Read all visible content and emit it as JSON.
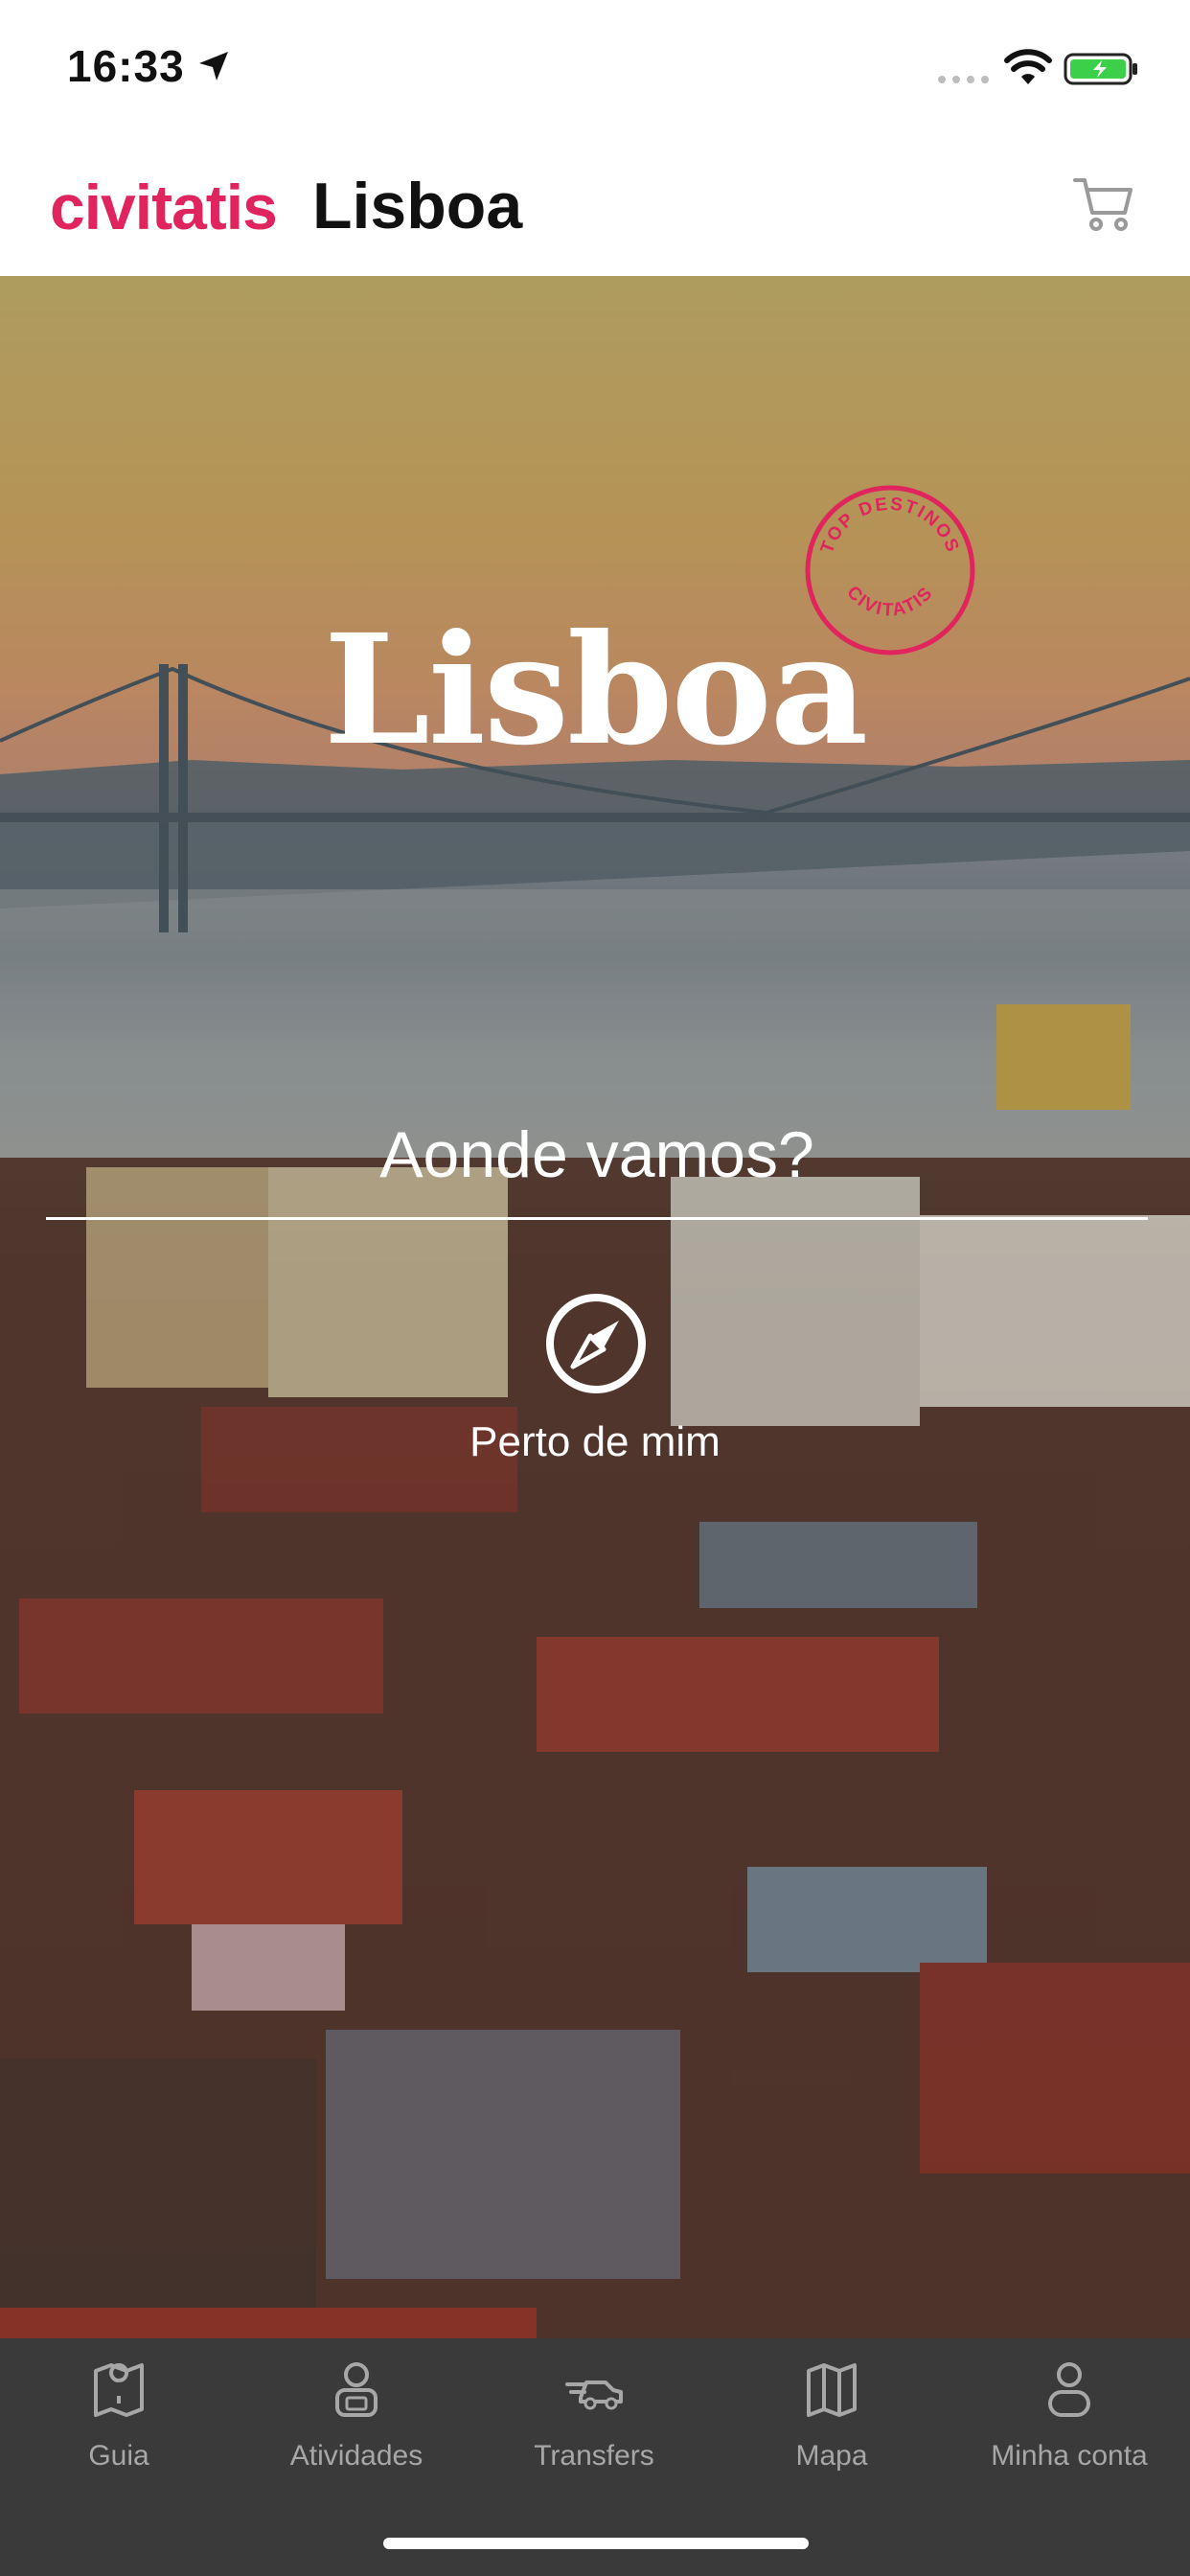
{
  "status": {
    "time": "16:33"
  },
  "header": {
    "brand": "civitatis",
    "city": "Lisboa"
  },
  "hero": {
    "title": "Lisboa",
    "stamp_top": "TOP DESTINOS",
    "stamp_bottom": "CIVITATIS",
    "search_label": "Aonde vamos?",
    "near_me_label": "Perto de mim"
  },
  "tabs": [
    {
      "label": "Guia",
      "icon": "map-pin-icon"
    },
    {
      "label": "Atividades",
      "icon": "guide-person-icon"
    },
    {
      "label": "Transfers",
      "icon": "car-icon"
    },
    {
      "label": "Mapa",
      "icon": "map-icon"
    },
    {
      "label": "Minha conta",
      "icon": "user-icon"
    }
  ],
  "colors": {
    "brand": "#e0245e",
    "tabbar": "#3a3a3a",
    "tab_label": "#a7a7a7"
  }
}
